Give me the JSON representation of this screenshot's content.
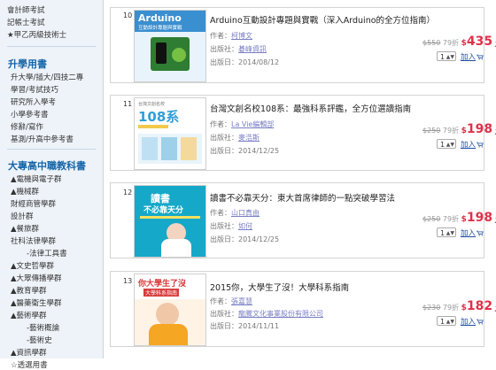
{
  "sidebar": {
    "top_links": [
      "會計師考試",
      "記帳士考試",
      "★甲乙丙級技術士"
    ],
    "sections": [
      {
        "title": "升學用書",
        "items": [
          "升大學/插大/四技二專",
          "學習/考試技巧",
          "研究所入學考",
          "小學參考書",
          "修辭/寫作",
          "基測/升高中參考書"
        ]
      },
      {
        "title": "大專高中職教科書",
        "items": [
          "▲電機與電子群",
          "▲機械群",
          "財經商管學群",
          "設計群",
          "▲餐旅群",
          "社科法律學群",
          "-法律工具書",
          "▲文史哲學群",
          "▲大眾傳播學群",
          "▲教育學群",
          "▲醫藥衛生學群",
          "▲藝術學群",
          "-藝術概論",
          "-藝術史",
          "▲資訊學群",
          "☆透選用書"
        ]
      }
    ]
  },
  "labels": {
    "author": "作者：",
    "publisher": "出版社：",
    "date": "出版日：",
    "add_to_cart": "加入",
    "currency": "$",
    "unit": "元"
  },
  "books": [
    {
      "num": "10",
      "title": "Arduino互動設計專題與實戰（深入Arduino的全方位指南）",
      "author": "柯博文",
      "publisher": "碁峰資訊",
      "date": "2014/08/12",
      "orig_price": "$550",
      "discount": "79折",
      "price": "435",
      "qty": "1",
      "cover": {
        "brand": "Arduino",
        "line1": "互動設計專題與實戰",
        "color": "#3a8fd0"
      }
    },
    {
      "num": "11",
      "title": "台灣文創名校108系：最強科系評鑑，全方位選讀指南",
      "author": "La Vie編輯部",
      "publisher": "麥浩斯",
      "date": "2014/12/25",
      "orig_price": "$250",
      "discount": "79折",
      "price": "198",
      "qty": "1",
      "cover": {
        "brand": "108系",
        "line1": "台灣文創名校",
        "color": "#2f9fd7"
      }
    },
    {
      "num": "12",
      "title": "讀書不必靠天分：東大首席律師的一點突破學習法",
      "author": "山口真由",
      "publisher": "如何",
      "date": "2014/12/25",
      "orig_price": "$250",
      "discount": "79折",
      "price": "198",
      "qty": "1",
      "cover": {
        "brand": "讀書",
        "line1": "不必靠天分",
        "color": "#16a8c9"
      }
    },
    {
      "num": "13",
      "title": "2015你，大學生了沒！大學科系指南",
      "author": "張嘉慧",
      "publisher": "龍騰文化事業股份有限公司",
      "date": "2014/11/11",
      "orig_price": "$230",
      "discount": "79折",
      "price": "182",
      "qty": "1",
      "cover": {
        "brand": "你大學生了沒",
        "line1": "大學科系指南",
        "color": "#d93b3b"
      }
    }
  ],
  "colors": {
    "sidebar_bg": "#eef3f9",
    "section_title": "#1565a8",
    "price": "#e0304a",
    "link": "#7b7fc4",
    "add_cart": "#1f4fa8"
  }
}
